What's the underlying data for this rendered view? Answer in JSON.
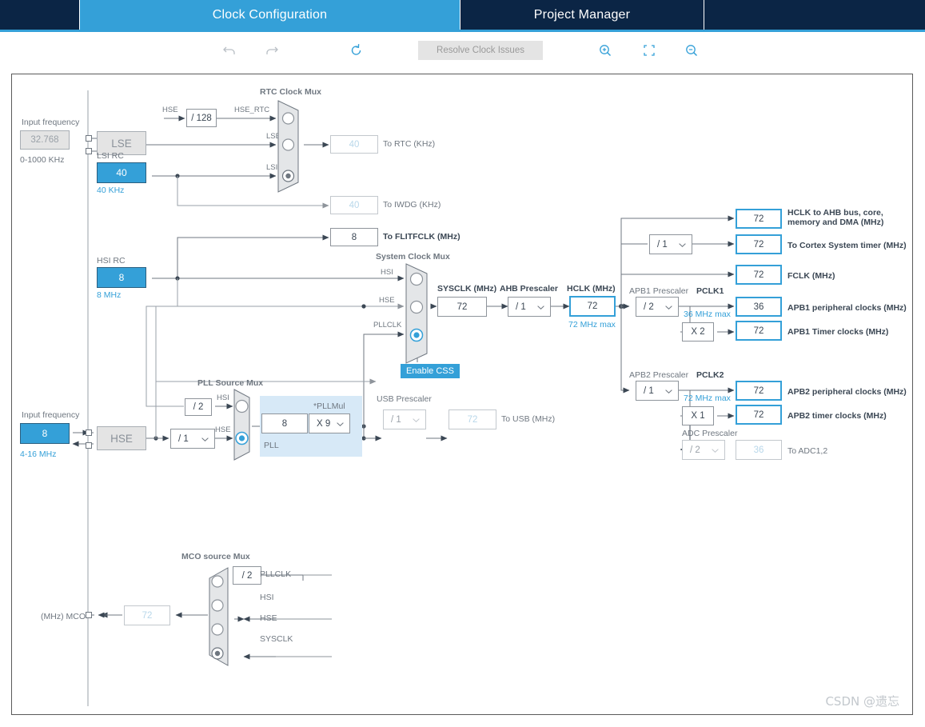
{
  "header": {
    "tabs": [
      {
        "label": "",
        "state": "spacer"
      },
      {
        "label": "Clock Configuration",
        "state": "active"
      },
      {
        "label": "Project Manager",
        "state": "normal"
      },
      {
        "label": "",
        "state": "tail"
      }
    ]
  },
  "toolbar": {
    "undo": "undo-icon",
    "redo": "redo-icon",
    "refresh": "refresh-icon",
    "resolve_label": "Resolve Clock Issues",
    "zoom_in": "zoom-in-icon",
    "fit": "fit-screen-icon",
    "zoom_out": "zoom-out-icon"
  },
  "lse": {
    "input_frequency_label": "Input frequency",
    "value": "32.768",
    "range": "0-1000 KHz",
    "osc_label": "LSE"
  },
  "hse": {
    "input_frequency_label": "Input frequency",
    "value": "8",
    "range": "4-16 MHz",
    "osc_label": "HSE",
    "prescaler": "/ 1"
  },
  "lsi": {
    "title": "LSI RC",
    "value": "40",
    "unit": "40 KHz"
  },
  "hsi": {
    "title": "HSI RC",
    "value": "8",
    "unit": "8 MHz"
  },
  "rtc_mux": {
    "title": "RTC Clock Mux",
    "inputs": [
      "HSE_RTC",
      "LSE",
      "LSI"
    ],
    "selected_index": 2,
    "hse_div_label": "HSE",
    "hse_divider": "/ 128"
  },
  "outputs": {
    "to_rtc": {
      "value": "40",
      "label": "To RTC (KHz)"
    },
    "to_iwdg": {
      "value": "40",
      "label": "To IWDG (KHz)"
    },
    "to_flitfclk": {
      "value": "8",
      "label": "To FLITFCLK (MHz)"
    }
  },
  "system_clock_mux": {
    "title": "System Clock Mux",
    "inputs": [
      "HSI",
      "HSE",
      "PLLCLK"
    ],
    "selected_index": 2,
    "enable_css": "Enable CSS"
  },
  "sysclk": {
    "label": "SYSCLK (MHz)",
    "value": "72"
  },
  "ahb_prescaler": {
    "label": "AHB Prescaler",
    "value": "/ 1"
  },
  "hclk": {
    "label": "HCLK (MHz)",
    "value": "72",
    "max": "72 MHz max"
  },
  "pll": {
    "source_mux_title": "PLL Source Mux",
    "inputs": [
      "HSI",
      "HSE"
    ],
    "selected_index": 1,
    "hsi_divider": "/ 2",
    "block_label": "PLL",
    "input_value": "8",
    "mul_label": "*PLLMul",
    "mul_value": "X 9"
  },
  "usb": {
    "prescaler_label": "USB Prescaler",
    "prescaler_value": "/ 1",
    "value": "72",
    "label": "To USB (MHz)"
  },
  "ahb_outputs": [
    {
      "value": "72",
      "label": "HCLK to AHB bus, core,",
      "label2": "memory and DMA (MHz)"
    },
    {
      "value": "72",
      "label": "To Cortex System timer (MHz)",
      "prescaler": "/ 1"
    },
    {
      "value": "72",
      "label": "FCLK (MHz)"
    }
  ],
  "apb1": {
    "prescaler_label": "APB1 Prescaler",
    "prescaler_value": "/ 2",
    "pclk_label": "PCLK1",
    "pclk_max": "36 MHz max",
    "peripheral": {
      "value": "36",
      "label": "APB1 peripheral clocks (MHz)"
    },
    "timer_mul": "X 2",
    "timer": {
      "value": "72",
      "label": "APB1 Timer clocks (MHz)"
    }
  },
  "apb2": {
    "prescaler_label": "APB2 Prescaler",
    "prescaler_value": "/ 1",
    "pclk_label": "PCLK2",
    "pclk_max": "72 MHz max",
    "peripheral": {
      "value": "72",
      "label": "APB2 peripheral clocks (MHz)"
    },
    "timer_mul": "X 1",
    "timer": {
      "value": "72",
      "label": "APB2 timer clocks (MHz)"
    },
    "adc_prescaler_label": "ADC Prescaler",
    "adc_prescaler_value": "/ 2",
    "adc": {
      "value": "36",
      "label": "To ADC1,2"
    }
  },
  "mco": {
    "title": "MCO source Mux",
    "inputs": [
      "PLLCLK",
      "HSI",
      "HSE",
      "SYSCLK"
    ],
    "selected_index": 3,
    "pll_divider": "/ 2",
    "value": "72",
    "label": "(MHz) MCO"
  },
  "watermark": "CSDN @遗忘"
}
